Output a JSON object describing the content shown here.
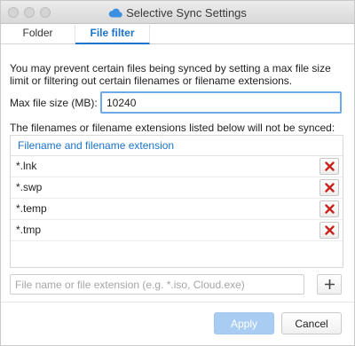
{
  "window": {
    "title": "Selective Sync Settings",
    "title_icon": "cloud-icon",
    "traffic_lights": [
      "close",
      "minimize",
      "zoom"
    ]
  },
  "tabs": [
    {
      "label": "Folder",
      "active": false
    },
    {
      "label": "File filter",
      "active": true
    }
  ],
  "file_filter": {
    "description": "You may prevent certain files being synced by setting a max file size limit or filtering out certain filenames or filename extensions.",
    "max_size_label": "Max file size (MB):",
    "max_size_value": "10240",
    "list_note": "The filenames or filename extensions listed below will not be synced:",
    "list_header": "Filename and filename extension",
    "items": [
      {
        "label": "*.lnk",
        "delete_icon": "delete-x-icon"
      },
      {
        "label": "*.swp",
        "delete_icon": "delete-x-icon"
      },
      {
        "label": "*.temp",
        "delete_icon": "delete-x-icon"
      },
      {
        "label": "*.tmp",
        "delete_icon": "delete-x-icon"
      }
    ],
    "add_placeholder": "File name or file extension (e.g. *.iso, Cloud.exe)",
    "add_value": "",
    "add_icon": "plus-icon"
  },
  "buttons": {
    "apply": "Apply",
    "cancel": "Cancel"
  },
  "colors": {
    "accent": "#1a73c8",
    "apply_disabled": "#a9cdf2",
    "delete": "#c8231c"
  }
}
